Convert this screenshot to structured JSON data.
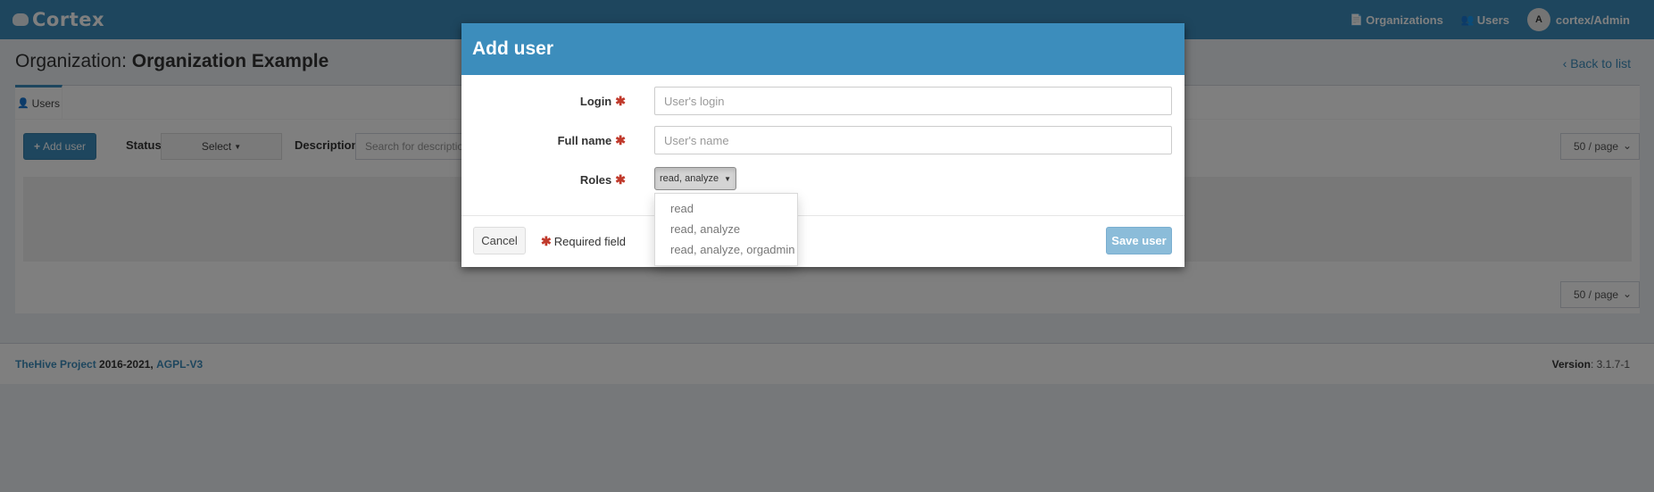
{
  "app": {
    "brand": "Cortex"
  },
  "nav": {
    "organizations": "Organizations",
    "users": "Users",
    "avatar_initial": "A",
    "user": "cortex/Admin"
  },
  "page": {
    "title_prefix": "Organization:",
    "org_name": "Organization Example",
    "back_link": "Back to list"
  },
  "tabs": [
    {
      "label": "Users"
    }
  ],
  "toolbar": {
    "add_user": "Add user",
    "status_label": "Status",
    "status_select": "Select",
    "description_label": "Description",
    "description_placeholder": "Search for descriptio",
    "page_size_top": "50 / page",
    "page_size_bottom": "50 / page"
  },
  "footer": {
    "project": "TheHive Project",
    "years": "2016-2021,",
    "license": "AGPL-V3",
    "version_label": "Version",
    "version_value": ": 3.1.7-1"
  },
  "modal": {
    "title": "Add user",
    "login_label": "Login",
    "login_placeholder": "User's login",
    "fullname_label": "Full name",
    "fullname_placeholder": "User's name",
    "roles_label": "Roles",
    "roles_selected": "read, analyze",
    "roles_options": [
      "read",
      "read, analyze",
      "read, analyze, orgadmin"
    ],
    "cancel": "Cancel",
    "required_note": "Required field",
    "save": "Save user"
  },
  "colors": {
    "primary": "#3c8dbc",
    "required": "#c0392b",
    "save_disabled": "#8bbcd9"
  }
}
